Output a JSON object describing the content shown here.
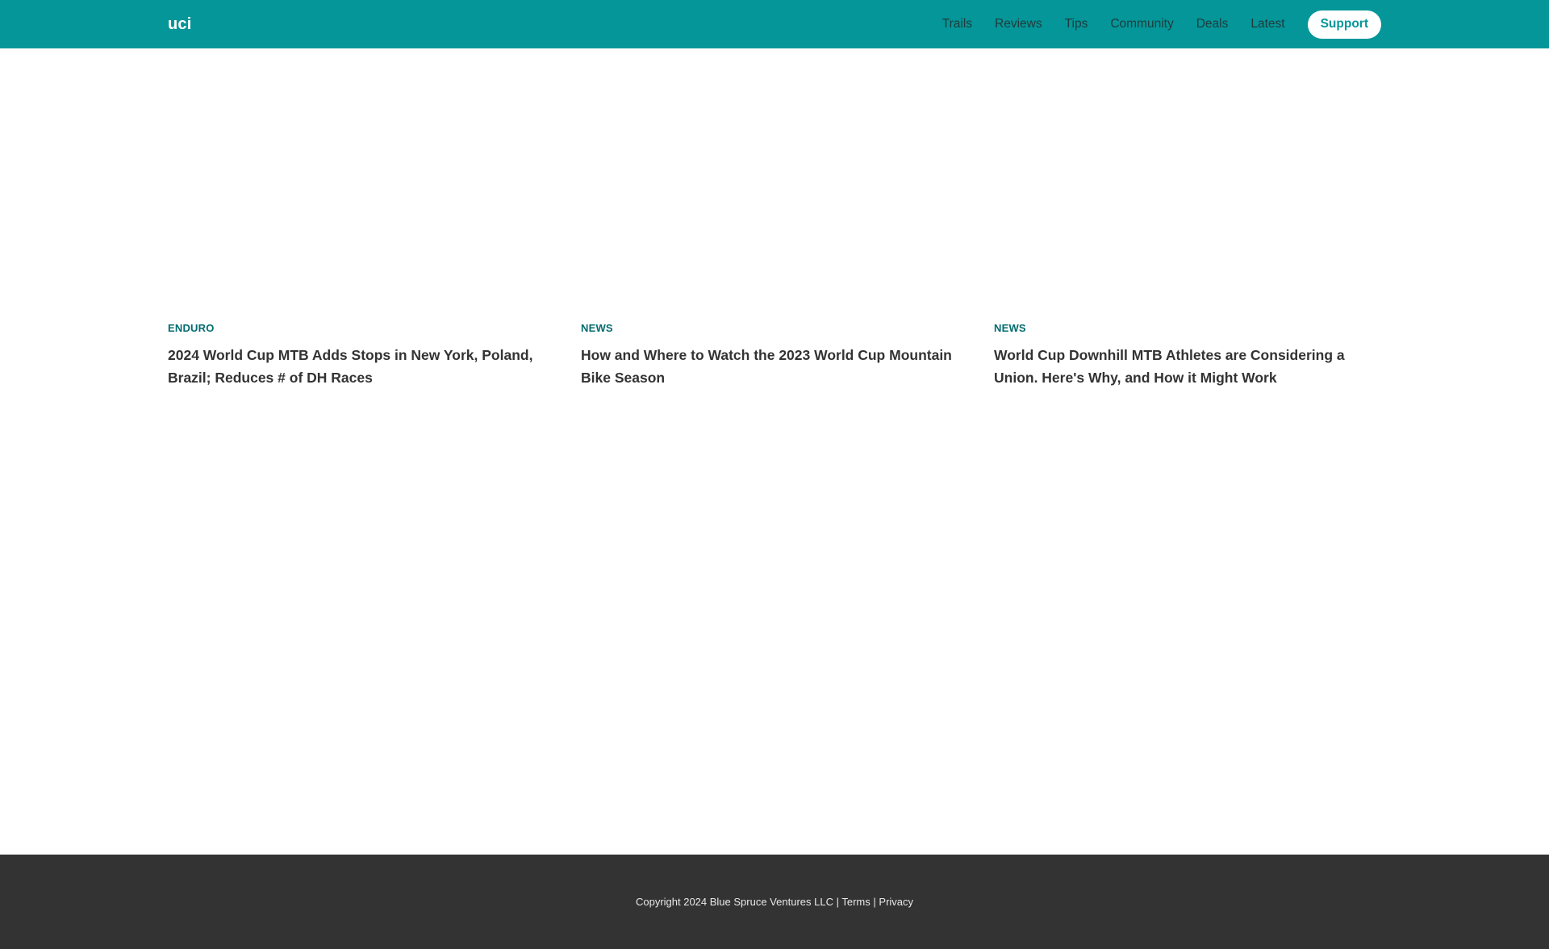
{
  "header": {
    "logo": "uci",
    "nav": [
      "Trails",
      "Reviews",
      "Tips",
      "Community",
      "Deals",
      "Latest"
    ],
    "support_label": "Support"
  },
  "articles": [
    {
      "category": "ENDURO",
      "title": "2024 World Cup MTB Adds Stops in New York, Poland, Brazil; Reduces # of DH Races"
    },
    {
      "category": "NEWS",
      "title": "How and Where to Watch the 2023 World Cup Mountain Bike Season"
    },
    {
      "category": "NEWS",
      "title": "World Cup Downhill MTB Athletes are Considering a Union. Here's Why, and How it Might Work"
    }
  ],
  "footer": {
    "copyright": "Copyright 2024 Blue Spruce Ventures LLC",
    "separator": "|",
    "terms": "Terms",
    "privacy": "Privacy"
  },
  "colors": {
    "header_bg": "#049699",
    "category": "#036b6e",
    "title": "#333333",
    "footer_bg": "#333333"
  }
}
